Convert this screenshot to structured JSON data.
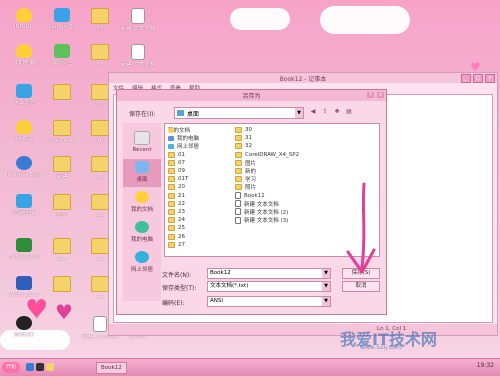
{
  "desktop": {
    "icons": [
      {
        "label": "INDIGO",
        "kind": "heart-y"
      },
      {
        "label": "百度网盘",
        "kind": "blue"
      },
      {
        "label": "07",
        "kind": "folder"
      },
      {
        "label": "新建 文本文档",
        "kind": "doc"
      },
      {
        "label": "我的电脑",
        "kind": "heart-y"
      },
      {
        "label": "360安全",
        "kind": "green"
      },
      {
        "label": "08",
        "kind": "folder"
      },
      {
        "label": "新建 文本文档",
        "kind": "doc"
      },
      {
        "label": "网上邻居",
        "kind": "blue"
      },
      {
        "label": "",
        "kind": "folder"
      },
      {
        "label": "09",
        "kind": "folder"
      },
      {
        "label": "回收站",
        "kind": "heart-y"
      },
      {
        "label": "CorelDRAW",
        "kind": "folder"
      },
      {
        "label": "10",
        "kind": "folder"
      },
      {
        "label": "Internet Explorer",
        "kind": "ie"
      },
      {
        "label": "新建",
        "kind": "folder"
      },
      {
        "label": "11",
        "kind": "folder"
      },
      {
        "label": "宽带连接",
        "kind": "blue"
      },
      {
        "label": "图片",
        "kind": "folder"
      },
      {
        "label": "12",
        "kind": "folder"
      },
      {
        "label": "Excel 2003",
        "kind": "excel"
      },
      {
        "label": "01T",
        "kind": "folder"
      },
      {
        "label": "13",
        "kind": "folder"
      },
      {
        "label": "Word 2003",
        "kind": "word"
      },
      {
        "label": "",
        "kind": "folder"
      },
      {
        "label": "14",
        "kind": "folder"
      },
      {
        "label": "腾讯QQ",
        "kind": "qq"
      },
      {
        "label": "新建 文本文档",
        "kind": "doc"
      },
      {
        "label": "Book1",
        "kind": "doc"
      }
    ]
  },
  "notepad": {
    "title": "Book12 - 记事本",
    "menu": [
      "文件",
      "编辑",
      "格式",
      "查看",
      "帮助"
    ],
    "status": "Ln 1, Col 1"
  },
  "dialog": {
    "title": "另存为",
    "look_in_label": "保存在(I):",
    "look_in_value": "桌面",
    "places": [
      "Recent",
      "桌面",
      "我的文档",
      "我的电脑",
      "网上邻居"
    ],
    "files_col1": [
      {
        "name": "我的文档",
        "icon": "heart"
      },
      {
        "name": "我的电脑",
        "icon": "comp"
      },
      {
        "name": "网上邻居",
        "icon": "net"
      },
      {
        "name": "01",
        "icon": "fold"
      },
      {
        "name": "07",
        "icon": "fold"
      },
      {
        "name": "09",
        "icon": "fold"
      },
      {
        "name": "01T",
        "icon": "fold"
      },
      {
        "name": "20",
        "icon": "fold"
      },
      {
        "name": "21",
        "icon": "fold"
      },
      {
        "name": "22",
        "icon": "fold"
      },
      {
        "name": "23",
        "icon": "fold"
      },
      {
        "name": "24",
        "icon": "fold"
      },
      {
        "name": "25",
        "icon": "fold"
      },
      {
        "name": "26",
        "icon": "fold"
      },
      {
        "name": "27",
        "icon": "fold"
      }
    ],
    "files_col2": [
      {
        "name": "30",
        "icon": "fold"
      },
      {
        "name": "31",
        "icon": "fold"
      },
      {
        "name": "32",
        "icon": "fold"
      },
      {
        "name": "CorelDRAW_X4_SP2",
        "icon": "fold"
      },
      {
        "name": "图片",
        "icon": "fold"
      },
      {
        "name": "新的",
        "icon": "fold"
      },
      {
        "name": "学习",
        "icon": "fold"
      },
      {
        "name": "照片",
        "icon": "fold"
      },
      {
        "name": "Book11",
        "icon": "txt"
      },
      {
        "name": "新建 文本文档",
        "icon": "txt"
      },
      {
        "name": "新建 文本文档 (2)",
        "icon": "txt"
      },
      {
        "name": "新建 文本文档 (3)",
        "icon": "txt"
      }
    ],
    "filename_label": "文件名(N):",
    "filename_value": "Book12",
    "filetype_label": "保存类型(T):",
    "filetype_value": "文本文档(*.txt)",
    "encoding_label": "编码(E):",
    "encoding_value": "ANSI",
    "save_label": "保存(S)",
    "cancel_label": "取消"
  },
  "taskbar": {
    "start": "开始",
    "item1": "Book12",
    "clock": "19:32"
  },
  "watermark": {
    "main": "我爱IT技术网",
    "sub": "www.52ij.com"
  }
}
